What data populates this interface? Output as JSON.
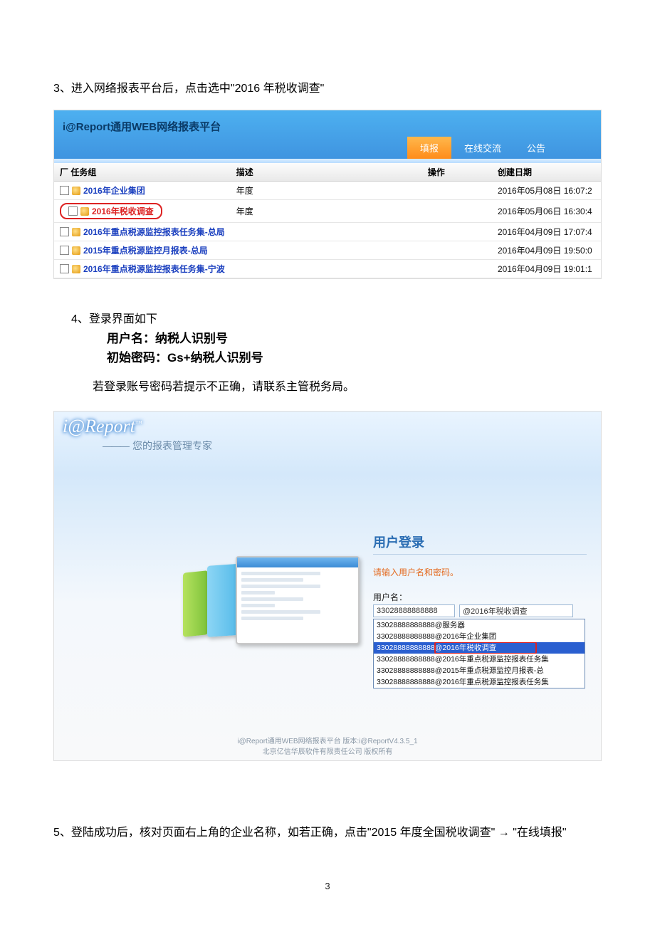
{
  "step3": "3、进入网络报表平台后，点击选中\"2016 年税收调查\"",
  "shot1": {
    "title": "i@Report通用WEB网络报表平台",
    "tabs": {
      "fill": "填报",
      "chat": "在线交流",
      "notice": "公告"
    },
    "headers": {
      "group": "厂 任务组",
      "desc": "描述",
      "op": "操作",
      "date": "创建日期"
    },
    "rows": [
      {
        "name": "2016年企业集团",
        "desc": "年度",
        "date": "2016年05月08日 16:07:2",
        "hl": false
      },
      {
        "name": "2016年税收调查",
        "desc": "年度",
        "date": "2016年05月06日 16:30:4",
        "hl": true
      },
      {
        "name": "2016年重点税源监控报表任务集-总局",
        "desc": "",
        "date": "2016年04月09日 17:07:4",
        "hl": false
      },
      {
        "name": "2015年重点税源监控月报表-总局",
        "desc": "",
        "date": "2016年04月09日 19:50:0",
        "hl": false
      },
      {
        "name": "2016年重点税源监控报表任务集-宁波",
        "desc": "",
        "date": "2016年04月09日 19:01:1",
        "hl": false
      }
    ]
  },
  "step4": "4、登录界面如下",
  "cred_user": "用户名：纳税人识别号",
  "cred_pwd": "初始密码：Gs+纳税人识别号",
  "note": "若登录账号密码若提示不正确，请联系主管税务局。",
  "shot2": {
    "logo": "i@Report",
    "logo_tm": "™",
    "logo_sub_dash": "———",
    "logo_sub": "您的报表管理专家",
    "login_title": "用户登录",
    "login_hint": "请输入用户名和密码。",
    "label_user": "用户名：",
    "val_user": "33028888888888",
    "val_at": "@2016年税收调查",
    "dd": [
      "33028888888888@服务器",
      "33028888888888@2016年企业集团",
      "33028888888888@2016年税收调查",
      "33028888888888@2016年重点税源监控报表任务集",
      "33028888888888@2015年重点税源监控月报表-总",
      "33028888888888@2016年重点税源监控报表任务集"
    ],
    "footer1": "i@Report通用WEB网络报表平台 版本:i@ReportV4.3.5_1",
    "footer2": "北京亿信华辰软件有限责任公司 版权所有"
  },
  "step5": "5、登陆成功后，核对页面右上角的企业名称，如若正确，点击\"2015 年度全国税收调查\" → \"在线填报\"",
  "pagenum": "3"
}
